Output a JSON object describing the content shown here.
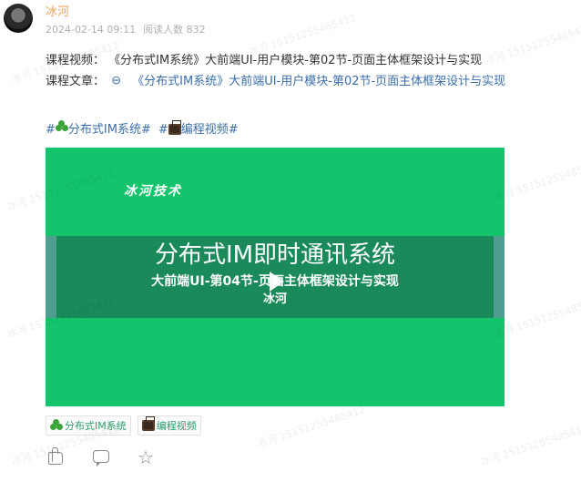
{
  "post": {
    "author": "冰河",
    "date": "2024-02-14 09:11",
    "read_label": "阅读人数",
    "read_count": "832"
  },
  "content": {
    "video_line_label": "课程视频：",
    "video_line_text": "《分布式IM系统》大前端UI-用户模块-第02节-页面主体框架设计与实现",
    "article_line_label": "课程文章：",
    "article_line_text": "《分布式IM系统》大前端UI-用户模块-第02节-页面主体框架设计与实现"
  },
  "hashtags": [
    {
      "prefix": "#",
      "text": "分布式IM系统#",
      "icon": "clover-icon"
    },
    {
      "prefix": "#",
      "text": "编程视频#",
      "icon": "tv-icon"
    }
  ],
  "video": {
    "brand": "冰河技术",
    "title": "分布式IM即时通讯系统",
    "subtitle": "大前端UI-第04节-页面主体框架设计与实现",
    "author": "冰河"
  },
  "tags": [
    {
      "text": "分布式IM系统",
      "icon": "clover-icon"
    },
    {
      "text": "编程视频",
      "icon": "tv-icon"
    }
  ],
  "actions": [
    "like-icon",
    "comment-icon",
    "favorite-icon"
  ],
  "watermark": "冰河 15151255485412",
  "colors": {
    "author": "#e8a15a",
    "link": "#3b6ea8",
    "video_bg": "#14c46d",
    "banner_bg": "#1a8a5a",
    "tag_text": "#2b9c68"
  }
}
